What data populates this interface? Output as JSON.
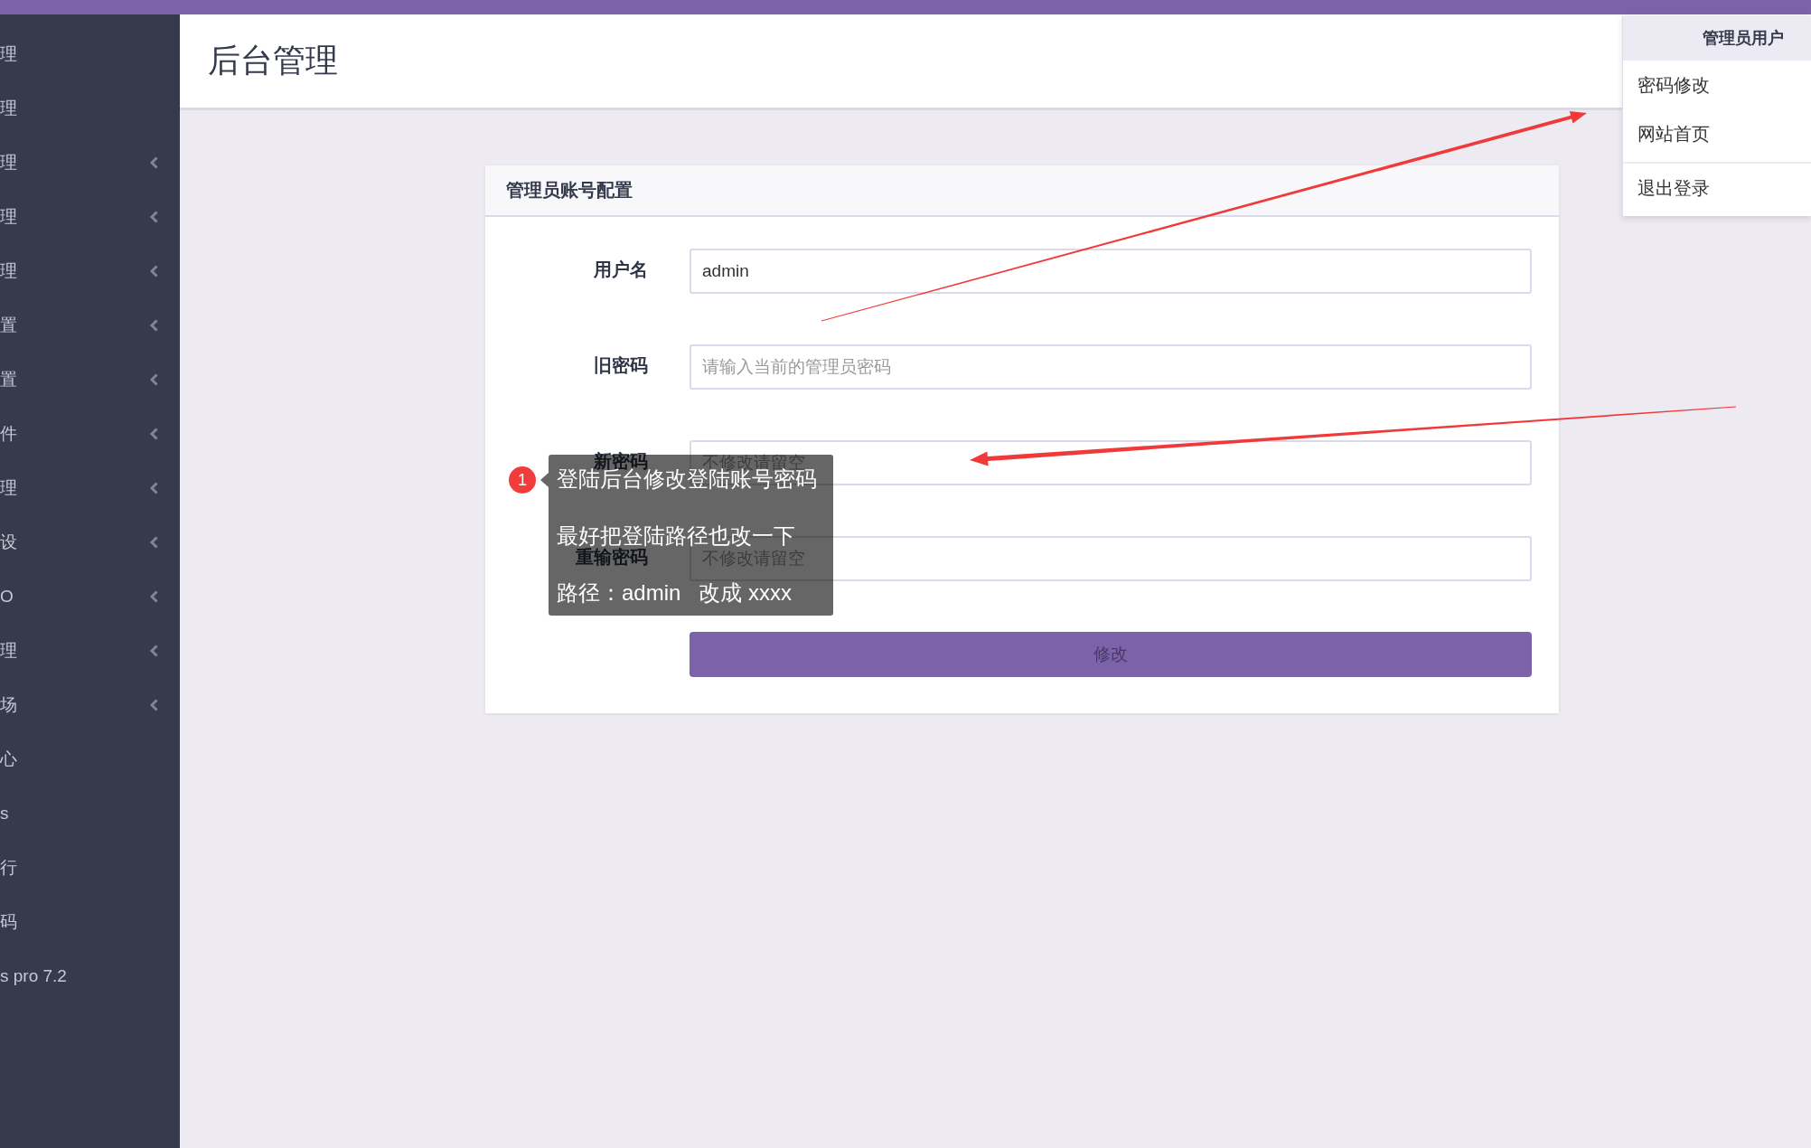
{
  "sidebar": {
    "items": [
      {
        "label": "理",
        "expandable": false
      },
      {
        "label": "理",
        "expandable": false
      },
      {
        "label": "理",
        "expandable": true
      },
      {
        "label": "理",
        "expandable": true
      },
      {
        "label": "理",
        "expandable": true
      },
      {
        "label": "置",
        "expandable": true
      },
      {
        "label": "置",
        "expandable": true
      },
      {
        "label": "件",
        "expandable": true
      },
      {
        "label": "理",
        "expandable": true
      },
      {
        "label": "设",
        "expandable": true
      },
      {
        "label": "O",
        "expandable": true
      },
      {
        "label": "理",
        "expandable": true
      },
      {
        "label": "场",
        "expandable": true
      },
      {
        "label": "心",
        "expandable": false
      },
      {
        "label": "s",
        "expandable": false
      },
      {
        "label": "行",
        "expandable": false
      },
      {
        "label": "码",
        "expandable": false
      },
      {
        "label": "s pro 7.2",
        "expandable": false
      }
    ]
  },
  "header": {
    "title": "后台管理"
  },
  "user_menu": {
    "title": "管理员用户",
    "groups": [
      {
        "items": [
          "密码修改",
          "网站首页"
        ]
      },
      {
        "items": [
          "退出登录"
        ]
      }
    ]
  },
  "card": {
    "title": "管理员账号配置",
    "fields": [
      {
        "label": "用户名",
        "value": "admin"
      },
      {
        "label": "旧密码",
        "placeholder": "请输入当前的管理员密码"
      },
      {
        "label": "新密码",
        "placeholder": "不修改请留空"
      },
      {
        "label": "重输密码",
        "placeholder": "不修改请留空"
      }
    ],
    "submit": "修改"
  },
  "annotation": {
    "badge": "1",
    "lines": [
      "登陆后台修改登陆账号密码",
      "最好把登陆路径也改一下",
      "路径：admin   改成 xxxx"
    ]
  }
}
